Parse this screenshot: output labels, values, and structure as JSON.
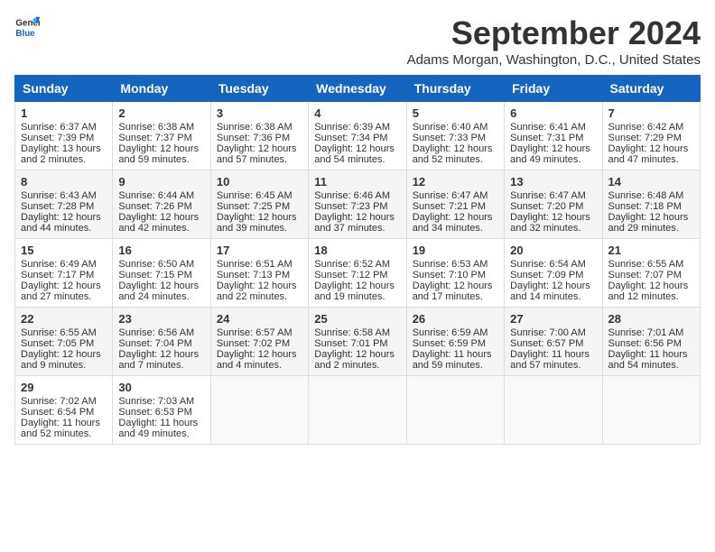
{
  "header": {
    "logo_general": "General",
    "logo_blue": "Blue",
    "month_title": "September 2024",
    "location": "Adams Morgan, Washington, D.C., United States"
  },
  "days_of_week": [
    "Sunday",
    "Monday",
    "Tuesday",
    "Wednesday",
    "Thursday",
    "Friday",
    "Saturday"
  ],
  "weeks": [
    [
      {
        "day": "1",
        "sunrise": "Sunrise: 6:37 AM",
        "sunset": "Sunset: 7:39 PM",
        "daylight": "Daylight: 13 hours and 2 minutes."
      },
      {
        "day": "2",
        "sunrise": "Sunrise: 6:38 AM",
        "sunset": "Sunset: 7:37 PM",
        "daylight": "Daylight: 12 hours and 59 minutes."
      },
      {
        "day": "3",
        "sunrise": "Sunrise: 6:38 AM",
        "sunset": "Sunset: 7:36 PM",
        "daylight": "Daylight: 12 hours and 57 minutes."
      },
      {
        "day": "4",
        "sunrise": "Sunrise: 6:39 AM",
        "sunset": "Sunset: 7:34 PM",
        "daylight": "Daylight: 12 hours and 54 minutes."
      },
      {
        "day": "5",
        "sunrise": "Sunrise: 6:40 AM",
        "sunset": "Sunset: 7:33 PM",
        "daylight": "Daylight: 12 hours and 52 minutes."
      },
      {
        "day": "6",
        "sunrise": "Sunrise: 6:41 AM",
        "sunset": "Sunset: 7:31 PM",
        "daylight": "Daylight: 12 hours and 49 minutes."
      },
      {
        "day": "7",
        "sunrise": "Sunrise: 6:42 AM",
        "sunset": "Sunset: 7:29 PM",
        "daylight": "Daylight: 12 hours and 47 minutes."
      }
    ],
    [
      {
        "day": "8",
        "sunrise": "Sunrise: 6:43 AM",
        "sunset": "Sunset: 7:28 PM",
        "daylight": "Daylight: 12 hours and 44 minutes."
      },
      {
        "day": "9",
        "sunrise": "Sunrise: 6:44 AM",
        "sunset": "Sunset: 7:26 PM",
        "daylight": "Daylight: 12 hours and 42 minutes."
      },
      {
        "day": "10",
        "sunrise": "Sunrise: 6:45 AM",
        "sunset": "Sunset: 7:25 PM",
        "daylight": "Daylight: 12 hours and 39 minutes."
      },
      {
        "day": "11",
        "sunrise": "Sunrise: 6:46 AM",
        "sunset": "Sunset: 7:23 PM",
        "daylight": "Daylight: 12 hours and 37 minutes."
      },
      {
        "day": "12",
        "sunrise": "Sunrise: 6:47 AM",
        "sunset": "Sunset: 7:21 PM",
        "daylight": "Daylight: 12 hours and 34 minutes."
      },
      {
        "day": "13",
        "sunrise": "Sunrise: 6:47 AM",
        "sunset": "Sunset: 7:20 PM",
        "daylight": "Daylight: 12 hours and 32 minutes."
      },
      {
        "day": "14",
        "sunrise": "Sunrise: 6:48 AM",
        "sunset": "Sunset: 7:18 PM",
        "daylight": "Daylight: 12 hours and 29 minutes."
      }
    ],
    [
      {
        "day": "15",
        "sunrise": "Sunrise: 6:49 AM",
        "sunset": "Sunset: 7:17 PM",
        "daylight": "Daylight: 12 hours and 27 minutes."
      },
      {
        "day": "16",
        "sunrise": "Sunrise: 6:50 AM",
        "sunset": "Sunset: 7:15 PM",
        "daylight": "Daylight: 12 hours and 24 minutes."
      },
      {
        "day": "17",
        "sunrise": "Sunrise: 6:51 AM",
        "sunset": "Sunset: 7:13 PM",
        "daylight": "Daylight: 12 hours and 22 minutes."
      },
      {
        "day": "18",
        "sunrise": "Sunrise: 6:52 AM",
        "sunset": "Sunset: 7:12 PM",
        "daylight": "Daylight: 12 hours and 19 minutes."
      },
      {
        "day": "19",
        "sunrise": "Sunrise: 6:53 AM",
        "sunset": "Sunset: 7:10 PM",
        "daylight": "Daylight: 12 hours and 17 minutes."
      },
      {
        "day": "20",
        "sunrise": "Sunrise: 6:54 AM",
        "sunset": "Sunset: 7:09 PM",
        "daylight": "Daylight: 12 hours and 14 minutes."
      },
      {
        "day": "21",
        "sunrise": "Sunrise: 6:55 AM",
        "sunset": "Sunset: 7:07 PM",
        "daylight": "Daylight: 12 hours and 12 minutes."
      }
    ],
    [
      {
        "day": "22",
        "sunrise": "Sunrise: 6:55 AM",
        "sunset": "Sunset: 7:05 PM",
        "daylight": "Daylight: 12 hours and 9 minutes."
      },
      {
        "day": "23",
        "sunrise": "Sunrise: 6:56 AM",
        "sunset": "Sunset: 7:04 PM",
        "daylight": "Daylight: 12 hours and 7 minutes."
      },
      {
        "day": "24",
        "sunrise": "Sunrise: 6:57 AM",
        "sunset": "Sunset: 7:02 PM",
        "daylight": "Daylight: 12 hours and 4 minutes."
      },
      {
        "day": "25",
        "sunrise": "Sunrise: 6:58 AM",
        "sunset": "Sunset: 7:01 PM",
        "daylight": "Daylight: 12 hours and 2 minutes."
      },
      {
        "day": "26",
        "sunrise": "Sunrise: 6:59 AM",
        "sunset": "Sunset: 6:59 PM",
        "daylight": "Daylight: 11 hours and 59 minutes."
      },
      {
        "day": "27",
        "sunrise": "Sunrise: 7:00 AM",
        "sunset": "Sunset: 6:57 PM",
        "daylight": "Daylight: 11 hours and 57 minutes."
      },
      {
        "day": "28",
        "sunrise": "Sunrise: 7:01 AM",
        "sunset": "Sunset: 6:56 PM",
        "daylight": "Daylight: 11 hours and 54 minutes."
      }
    ],
    [
      {
        "day": "29",
        "sunrise": "Sunrise: 7:02 AM",
        "sunset": "Sunset: 6:54 PM",
        "daylight": "Daylight: 11 hours and 52 minutes."
      },
      {
        "day": "30",
        "sunrise": "Sunrise: 7:03 AM",
        "sunset": "Sunset: 6:53 PM",
        "daylight": "Daylight: 11 hours and 49 minutes."
      },
      null,
      null,
      null,
      null,
      null
    ]
  ]
}
